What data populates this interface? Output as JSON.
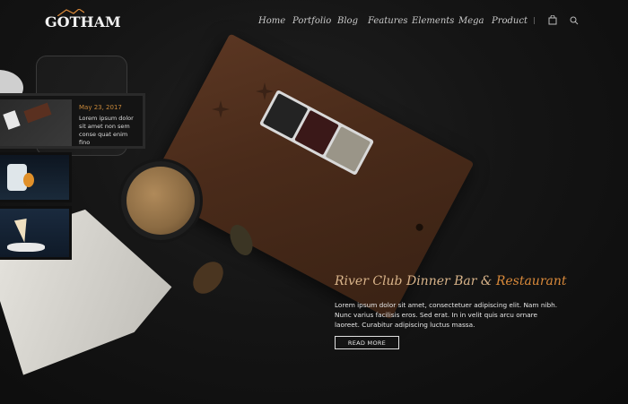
{
  "brand": {
    "name": "GOTHAM"
  },
  "nav": {
    "items": [
      "Home",
      "Portfolio",
      "Blog",
      "Features",
      "Elements",
      "Mega",
      "Product"
    ],
    "icons": [
      "cart-icon",
      "search-icon"
    ]
  },
  "side_panel": {
    "post": {
      "date": "May 23, 2017",
      "excerpt": "Lorem ipsum dolor sit amet non sem conse quat enim fino"
    }
  },
  "hero": {
    "title_main": "River Club Dinner Bar & ",
    "title_accent": "Restaurant",
    "description": "Lorem ipsum dolor sit amet, consectetuer adipiscing elit. Nam nibh. Nunc varius facilisis eros. Sed erat. In in velit quis arcu ornare laoreet. Curabitur adipiscing luctus massa.",
    "button_label": "READ MORE"
  },
  "colors": {
    "accent": "#d9893a",
    "background": "#151515"
  }
}
